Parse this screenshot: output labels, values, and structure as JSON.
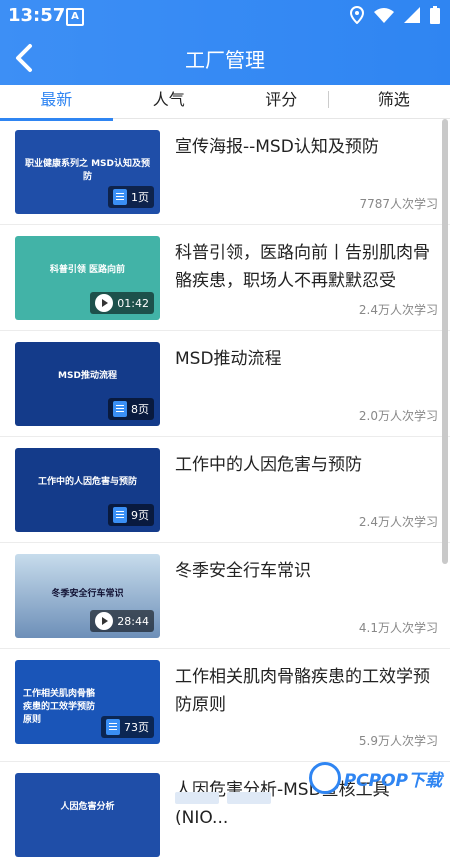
{
  "status": {
    "time": "13:57",
    "notification_icon": "A"
  },
  "header": {
    "title": "工厂管理"
  },
  "tabs": [
    "最新",
    "人气",
    "评分",
    "筛选"
  ],
  "items": [
    {
      "title": "宣传海报--MSD认知及预防",
      "count": "7787人次学习",
      "badge_type": "doc",
      "badge_text": "1页",
      "thumb_caption": "职业健康系列之 MSD认知及预防",
      "thumb_color": "#1f4ea8"
    },
    {
      "title": "科普引领，医路向前丨告别肌肉骨骼疾患，职场人不再默默忍受",
      "count": "2.4万人次学习",
      "badge_type": "video",
      "badge_text": "01:42",
      "thumb_caption": "科普引领 医路向前",
      "thumb_color": "#42b3a7"
    },
    {
      "title": "MSD推动流程",
      "count": "2.0万人次学习",
      "badge_type": "doc",
      "badge_text": "8页",
      "thumb_caption": "MSD推动流程",
      "thumb_color": "#143b8a"
    },
    {
      "title": "工作中的人因危害与预防",
      "count": "2.4万人次学习",
      "badge_type": "doc",
      "badge_text": "9页",
      "thumb_caption": "工作中的人因危害与预防",
      "thumb_color": "#143b8a"
    },
    {
      "title": "冬季安全行车常识",
      "count": "4.1万人次学习",
      "badge_type": "video",
      "badge_text": "28:44",
      "thumb_caption": "冬季安全行车常识",
      "thumb_color": "#6d8fb8"
    },
    {
      "title": "工作相关肌肉骨骼疾患的工效学预防原则",
      "count": "5.9万人次学习",
      "badge_type": "doc",
      "badge_text": "73页",
      "thumb_caption": "工作相关肌肉骨骼疾患的工效学预防原则",
      "thumb_color": "#1a55b8"
    },
    {
      "title": "人因危害分析-MSD查核工具(NIO...",
      "count": "",
      "badge_type": "none",
      "badge_text": "",
      "thumb_caption": "人因危害分析",
      "thumb_color": "#1f4ea8"
    }
  ],
  "watermark": {
    "text": "PCPOP下载"
  },
  "colors": {
    "accent": "#2f85f2"
  }
}
